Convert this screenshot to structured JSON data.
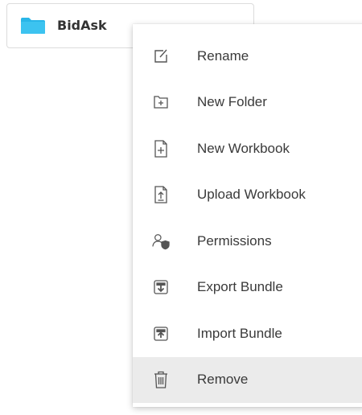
{
  "folder": {
    "name": "BidAsk",
    "icon": "folder-icon",
    "color": "#29b6e8"
  },
  "menu": {
    "items": [
      {
        "label": "Rename",
        "icon": "rename-icon"
      },
      {
        "label": "New Folder",
        "icon": "new-folder-icon"
      },
      {
        "label": "New Workbook",
        "icon": "new-workbook-icon"
      },
      {
        "label": "Upload Workbook",
        "icon": "upload-workbook-icon"
      },
      {
        "label": "Permissions",
        "icon": "permissions-icon"
      },
      {
        "label": "Export Bundle",
        "icon": "export-bundle-icon"
      },
      {
        "label": "Import Bundle",
        "icon": "import-bundle-icon"
      },
      {
        "label": "Remove",
        "icon": "trash-icon"
      }
    ],
    "hover_item": "Remove",
    "hover_color": "#ebebeb"
  }
}
